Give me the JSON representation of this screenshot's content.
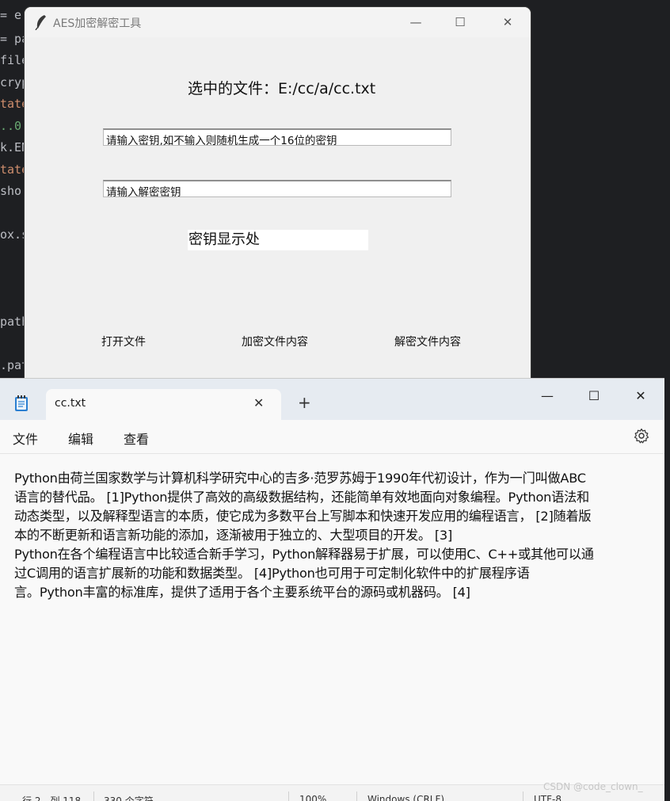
{
  "background_code": {
    "lines": [
      {
        "text": "= e"
      },
      {
        "text": "= pa"
      },
      {
        "text": "file"
      },
      {
        "text": "cryp"
      },
      {
        "text": "tate"
      },
      {
        "text": "..0'"
      },
      {
        "text": "k.EN"
      },
      {
        "text": "tate"
      },
      {
        "text": " sho"
      },
      {
        "text": "ox.s"
      },
      {
        "text": "path"
      },
      {
        "text": ".pat"
      }
    ]
  },
  "aes_window": {
    "title": "AES加密解密工具",
    "selected_file_text": "选中的文件：E:/cc/a/cc.txt",
    "key_input_value": "请输入密钥,如不输入则随机生成一个16位的密钥",
    "decrypt_key_input_value": "请输入解密密钥",
    "key_display_text": "密钥显示处",
    "buttons": {
      "open_file": "打开文件",
      "encrypt": "加密文件内容",
      "decrypt": "解密文件内容"
    },
    "controls": {
      "minimize": "—",
      "maximize": "☐",
      "close": "✕"
    }
  },
  "notepad": {
    "tab_title": "cc.txt",
    "tab_close": "✕",
    "new_tab": "+",
    "controls": {
      "minimize": "—",
      "maximize": "☐",
      "close": "✕"
    },
    "menu": {
      "file": "文件",
      "edit": "编辑",
      "view": "查看"
    },
    "content_lines": [
      "Python由荷兰国家数学与计算机科学研究中心的吉多·范罗苏姆于1990年代初设计，作为一门叫做ABC",
      "语言的替代品。 [1]Python提供了高效的高级数据结构，还能简单有效地面向对象编程。Python语法和",
      "动态类型，以及解释型语言的本质，使它成为多数平台上写脚本和快速开发应用的编程语言， [2]随着版",
      "本的不断更新和语言新功能的添加，逐渐被用于独立的、大型项目的开发。 [3]",
      "Python在各个编程语言中比较适合新手学习，Python解释器易于扩展，可以使用C、C++或其他可以通",
      "过C调用的语言扩展新的功能和数据类型。 [4]Python也可用于可定制化软件中的扩展程序语",
      "言。Python丰富的标准库，提供了适用于各个主要系统平台的源码或机器码。 [4]"
    ],
    "status": {
      "position": "行 2，列 118",
      "chars": "330 个字符",
      "zoom": "100%",
      "line_ending": "Windows (CRLF)",
      "encoding": "UTF-8"
    }
  },
  "watermark": "CSDN @code_clown_"
}
